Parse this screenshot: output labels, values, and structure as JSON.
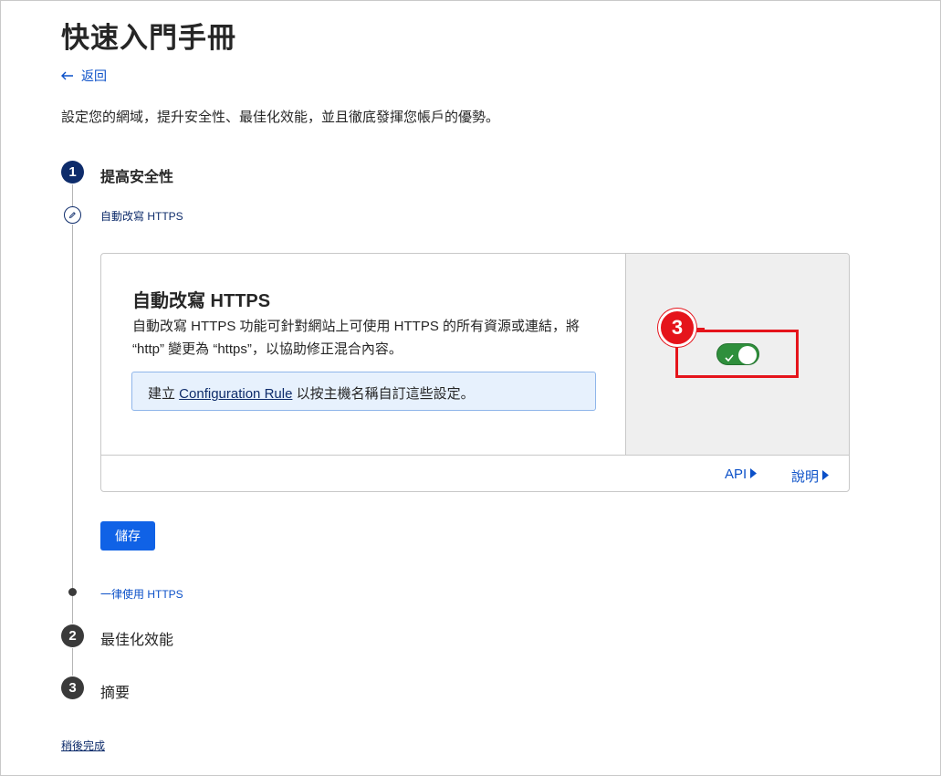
{
  "header": {
    "title": "快速入門手冊",
    "back_label": "返回",
    "description": "設定您的網域，提升安全性、最佳化效能，並且徹底發揮您帳戶的優勢。"
  },
  "steps": [
    {
      "number": "1",
      "label": "提高安全性",
      "state": "active"
    },
    {
      "number": "2",
      "label": "最佳化效能",
      "state": "inactive"
    },
    {
      "number": "3",
      "label": "摘要",
      "state": "inactive"
    }
  ],
  "substeps": {
    "current_label": "自動改寫 HTTPS",
    "next_label": "一律使用 HTTPS"
  },
  "card": {
    "title": "自動改寫 HTTPS",
    "description": "自動改寫 HTTPS 功能可針對網站上可使用 HTTPS 的所有資源或連結，將 “http” 變更為 “https”，以協助修正混合內容。",
    "info_prefix": "建立 ",
    "info_link": "Configuration Rule",
    "info_suffix": " 以按主機名稱自訂這些設定。",
    "toggle_on": true,
    "footer_api": "API",
    "footer_help": "說明"
  },
  "callout": {
    "number": "3",
    "color": "#e5141b"
  },
  "actions": {
    "save_label": "儲存",
    "finish_later_label": "稍後完成"
  },
  "colors": {
    "accent": "#1062e6",
    "link": "#0b50c8",
    "navy": "#0e2c6b",
    "toggle_on": "#2f8f3c"
  },
  "icons": {
    "back": "arrow-left-icon",
    "edit": "pencil-icon",
    "check": "check-icon",
    "caret": "caret-right-icon"
  }
}
